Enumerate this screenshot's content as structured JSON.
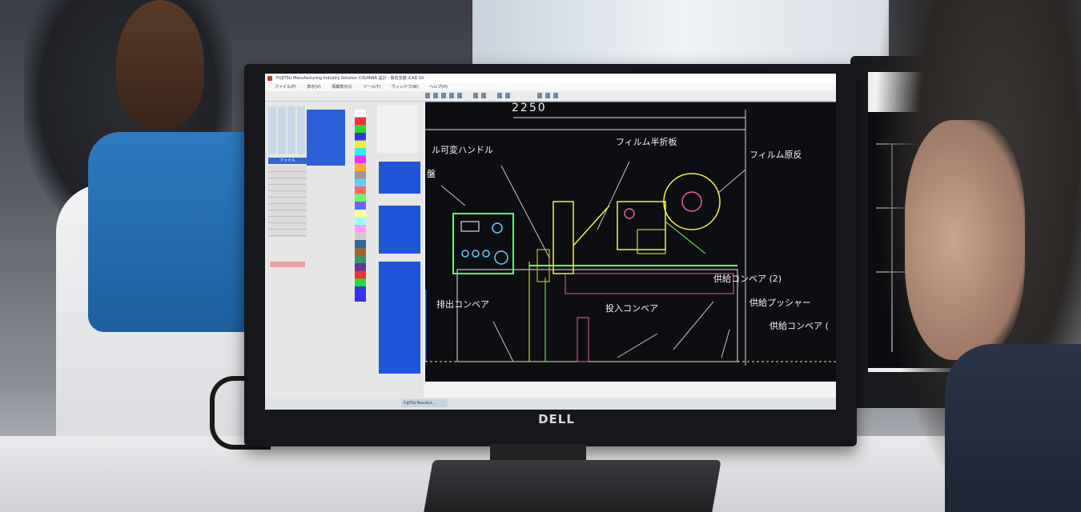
{
  "monitor": {
    "brand": "DELL"
  },
  "app": {
    "title": "FUJITSU Manufacturing Industry Solution COLMINA 設計・製造支援 iCAD SX",
    "menu": [
      "ファイル(F)",
      "表示(V)",
      "情報表示(I)",
      "ツール(T)",
      "ウィンドウ(W)",
      "ヘルプ(H)"
    ],
    "panel": {
      "file_label": "ファイル"
    },
    "taskbar_item": "FUJITSU Manufact..."
  },
  "drawing": {
    "dimension": "2250",
    "labels": {
      "handle": "ル可変ハンドル",
      "panel": "盤",
      "film_half_fold": "フィルム半折板",
      "film_roll": "フィルム原反",
      "supply_conveyor_2": "供給コンベア (2)",
      "discharge_conveyor": "排出コンベア",
      "input_conveyor": "投入コンベア",
      "supply_pusher": "供給プッシャー",
      "supply_conveyor": "供給コンベア ("
    }
  }
}
